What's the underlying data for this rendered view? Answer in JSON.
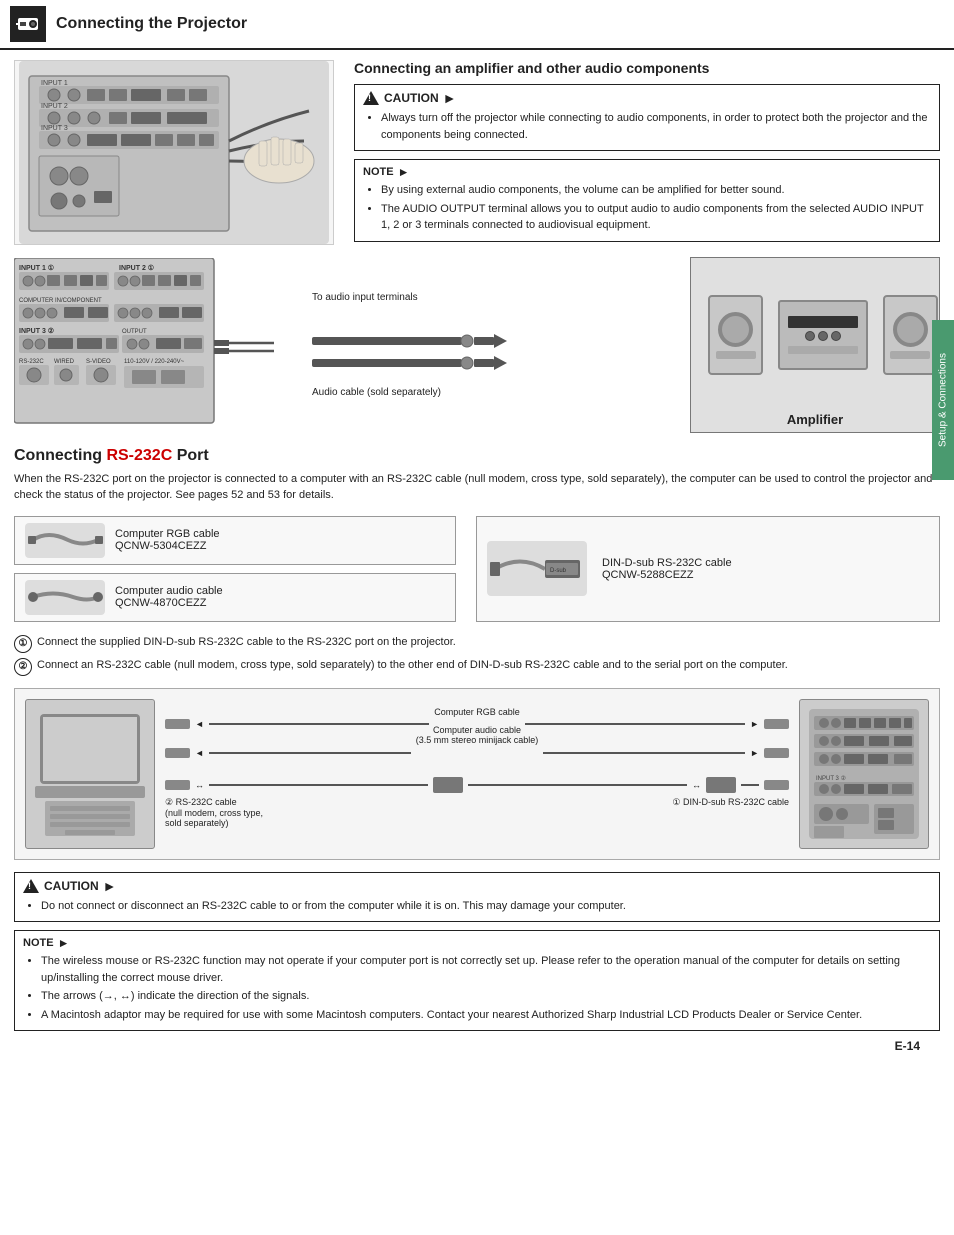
{
  "header": {
    "title": "Connecting the Projector",
    "icon": "projector-icon"
  },
  "side_tab": {
    "label": "Setup & Connections"
  },
  "section1": {
    "title": "Connecting an amplifier and other audio components",
    "caution_label": "CAUTION",
    "caution_arrow": "►",
    "caution_text": "Always turn off the projector while connecting to audio components, in order to protect both the projector and the components being connected.",
    "note_label": "NOTE",
    "note_arrow": "►",
    "note_items": [
      "By using external audio components, the volume can be amplified for better sound.",
      "The AUDIO OUTPUT terminal allows you to output audio to audio components from the selected AUDIO INPUT 1, 2 or 3 terminals connected to audiovisual equipment."
    ],
    "diagram_labels": {
      "to_audio": "To audio input terminals",
      "audio_cable": "Audio cable (sold separately)",
      "amplifier": "Amplifier"
    }
  },
  "section2": {
    "title_plain": "Connecting ",
    "title_highlight": "RS-232C",
    "title_rest": " Port",
    "description": "When the RS-232C port on the projector is connected to a computer with an RS-232C cable (null modem, cross type, sold separately), the computer can be used to control the projector and check the status of the projector. See pages 52 and 53 for details.",
    "cable1_label": "Computer RGB cable\nQCNW-5304CEZZ",
    "cable2_label": "Computer audio cable\nQCNW-4870CEZZ",
    "cable3_label": "DIN-D-sub RS-232C cable\nQCNW-5288CEZZ",
    "step1": "Connect the supplied DIN-D-sub RS-232C cable to the RS-232C port on the projector.",
    "step2": "Connect an RS-232C cable (null modem, cross type, sold separately) to the other end of DIN-D-sub RS-232C cable and to the serial port on the computer.",
    "diagram_labels": {
      "rgb_cable": "Computer RGB cable",
      "audio_cable": "Computer audio cable\n(3.5 mm stereo minijack cable)",
      "rs232c_cable": "② RS-232C cable\n(null modem, cross type,\nsold separately)",
      "din_cable": "① DIN-D-sub RS-232C cable"
    },
    "bottom_caution_label": "CAUTION",
    "bottom_caution_text": "Do not connect or disconnect an RS-232C cable to or from the computer while it is on. This may damage your computer.",
    "note_label": "NOTE",
    "note_items": [
      "The wireless mouse or RS-232C function may not operate if your computer port is not correctly set up. Please refer to the operation manual of the computer for details on setting up/installing the correct mouse driver.",
      "The arrows (→, ↔) indicate the direction of the signals.",
      "A Macintosh adaptor may be required for use with some Macintosh computers. Contact your nearest Authorized Sharp Industrial LCD Products Dealer or Service Center."
    ]
  },
  "page_number": "E-14"
}
